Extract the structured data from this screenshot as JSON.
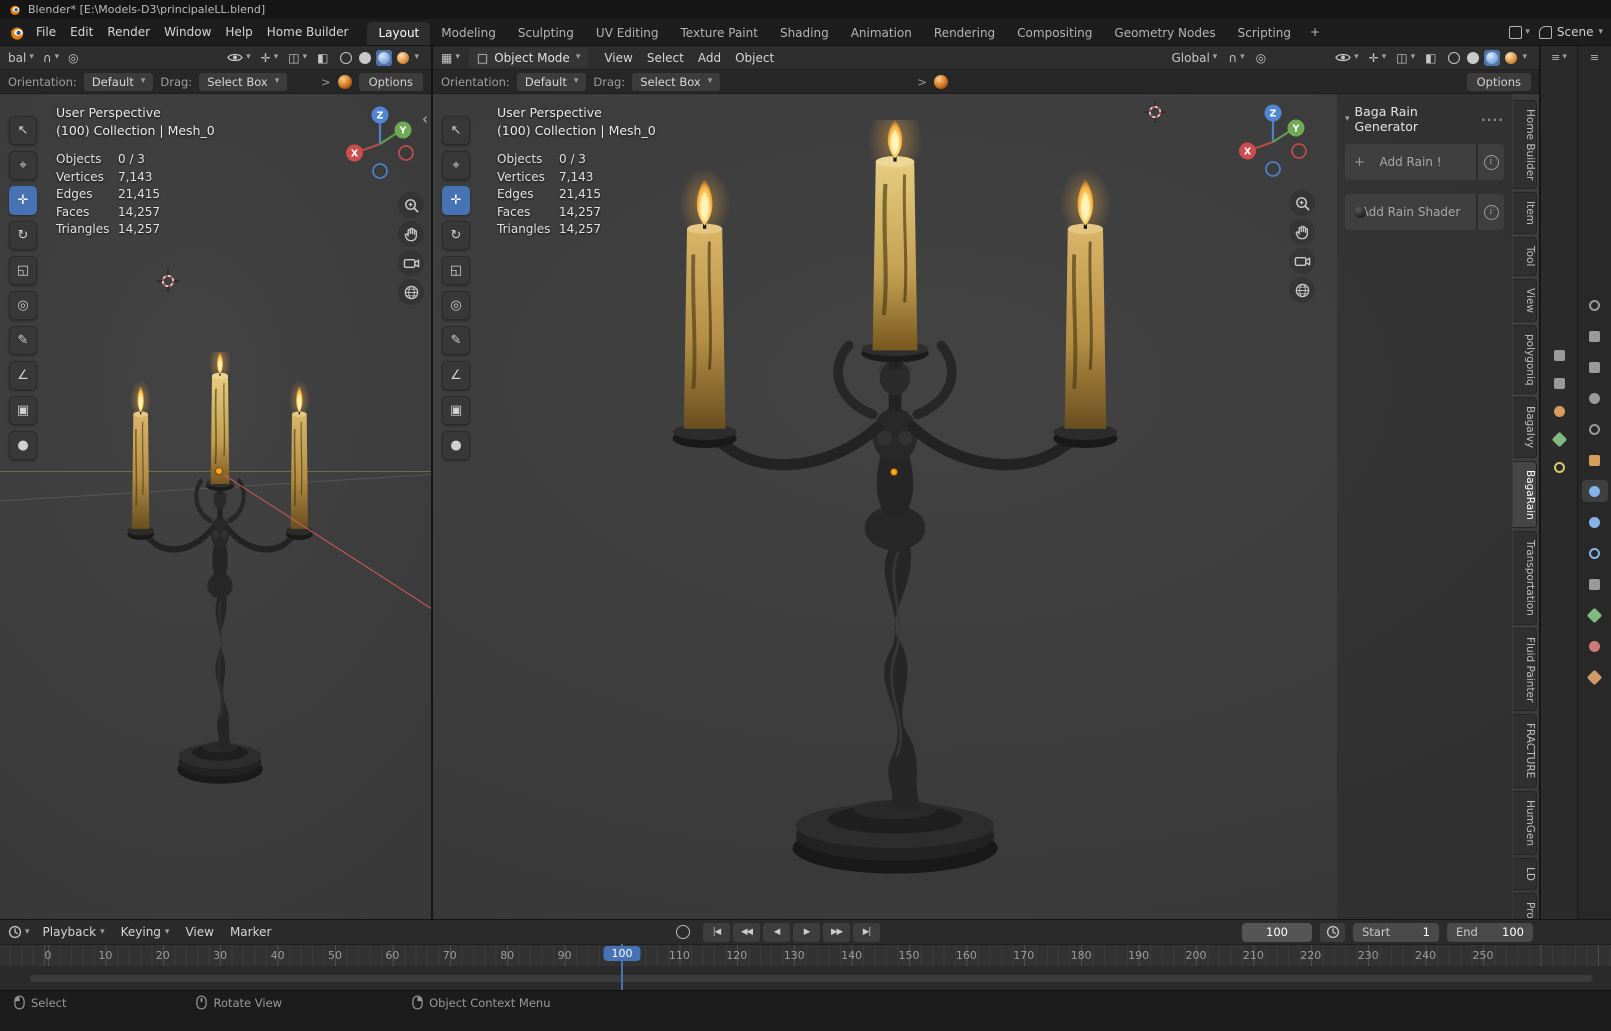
{
  "window": {
    "title": "Blender* [E:\\Models-D3\\principaleLL.blend]"
  },
  "icons": {
    "chevron_down": "▾",
    "expander": ">",
    "collapse_left": "‹",
    "magnet": "∩",
    "proportional_edit": "◎",
    "overlays": "◫",
    "xray": "◧",
    "gizmo_toggle": "✛",
    "editor_type_grid": "▦",
    "mode_cube": "□",
    "editor_list": "≡",
    "plus": "+",
    "info": "i",
    "panel_grip": "····"
  },
  "menubar": {
    "menus": [
      "File",
      "Edit",
      "Render",
      "Window",
      "Help",
      "Home Builder"
    ],
    "workspace_tabs": [
      "Layout",
      "Modeling",
      "Sculpting",
      "UV Editing",
      "Texture Paint",
      "Shading",
      "Animation",
      "Rendering",
      "Compositing",
      "Geometry Nodes",
      "Scripting"
    ],
    "active_tab": "Layout",
    "new_workspace_label": "+",
    "scene_selector": {
      "label": "Scene"
    }
  },
  "viewport_shared": {
    "header": {
      "mode_label": "Object Mode",
      "menus": [
        "View",
        "Select",
        "Add",
        "Object"
      ],
      "orientation": "Global"
    },
    "left_header_truncated": "bal",
    "tool_settings": {
      "orientation_label": "Orientation:",
      "orientation_value": "Default",
      "drag_label": "Drag:",
      "drag_value": "Select Box",
      "options_label": "Options"
    },
    "overlay": {
      "view_label": "User Perspective",
      "collection_label": "(100) Collection | Mesh_0",
      "stats": [
        {
          "label": "Objects",
          "value": "0 / 3"
        },
        {
          "label": "Vertices",
          "value": "7,143"
        },
        {
          "label": "Edges",
          "value": "21,415"
        },
        {
          "label": "Faces",
          "value": "14,257"
        },
        {
          "label": "Triangles",
          "value": "14,257"
        }
      ]
    }
  },
  "gizmo_axes": {
    "x": "X",
    "y": "Y",
    "z": "Z"
  },
  "tools": [
    {
      "name": "select-box",
      "glyph": "↖",
      "active": false
    },
    {
      "name": "cursor",
      "glyph": "⌖",
      "active": false
    },
    {
      "name": "move",
      "glyph": "✛",
      "active": true
    },
    {
      "name": "rotate",
      "glyph": "↻",
      "active": false
    },
    {
      "name": "scale",
      "glyph": "◱",
      "active": false
    },
    {
      "name": "transform",
      "glyph": "◎",
      "active": false
    },
    {
      "name": "annotate",
      "glyph": "✎",
      "active": false
    },
    {
      "name": "measure",
      "glyph": "∠",
      "active": false
    },
    {
      "name": "add-cube",
      "glyph": "▣",
      "active": false
    },
    {
      "name": "addon-tool",
      "glyph": "●",
      "active": false
    }
  ],
  "sidebar_panel": {
    "title": "Baga Rain Generator",
    "buttons": [
      {
        "label": "Add Rain !"
      },
      {
        "label": "Add Rain Shader"
      }
    ]
  },
  "sidebar_tabs": {
    "active": "BagaRain",
    "items": [
      "Home Builder",
      "Item",
      "Tool",
      "View",
      "polygoniq",
      "BagaIvy",
      "BagaRain",
      "Transportation",
      "Fluid Painter",
      "FRACTURE",
      "HumGen",
      "LD",
      "Procedural Cro"
    ]
  },
  "properties_tabs": {
    "items": [
      {
        "name": "render",
        "shape": "ring",
        "color": "#9a9a9a",
        "active": false
      },
      {
        "name": "output",
        "shape": "square",
        "color": "#9a9a9a",
        "active": false
      },
      {
        "name": "view-layer",
        "shape": "square",
        "color": "#9a9a9a",
        "active": false
      },
      {
        "name": "scene",
        "shape": "circle",
        "color": "#9a9a9a",
        "active": false
      },
      {
        "name": "world",
        "shape": "ring",
        "color": "#9a9a9a",
        "active": false
      },
      {
        "name": "object",
        "shape": "square",
        "color": "#d89c5a",
        "active": false
      },
      {
        "name": "modifiers",
        "shape": "circle",
        "color": "#84b3e8",
        "active": true
      },
      {
        "name": "particles",
        "shape": "circle",
        "color": "#84b3e8",
        "active": false
      },
      {
        "name": "physics",
        "shape": "ring",
        "color": "#84b3e8",
        "active": false
      },
      {
        "name": "constraints",
        "shape": "square",
        "color": "#9a9a9a",
        "active": false
      },
      {
        "name": "object-data",
        "shape": "diamond",
        "color": "#7fba7f",
        "active": false
      },
      {
        "name": "material",
        "shape": "circle",
        "color": "#cf7a7a",
        "active": false
      },
      {
        "name": "texture",
        "shape": "diamond",
        "color": "#cf9a6a",
        "active": false
      }
    ]
  },
  "outliner": {
    "items": [
      {
        "name": "filter",
        "shape": "square",
        "color": "#9a9a9a"
      },
      {
        "name": "collection",
        "shape": "square",
        "color": "#9a9a9a"
      },
      {
        "name": "object",
        "shape": "circle",
        "color": "#d89c5a"
      },
      {
        "name": "mesh-data",
        "shape": "diamond",
        "color": "#7fba7f"
      },
      {
        "name": "light",
        "shape": "ring",
        "color": "#d8c86a"
      }
    ]
  },
  "timeline": {
    "menus": [
      "Playback",
      "Keying",
      "View",
      "Marker"
    ],
    "transport": [
      {
        "name": "jump-to-start",
        "glyph": "|◀"
      },
      {
        "name": "prev-keyframe",
        "glyph": "◀◀"
      },
      {
        "name": "play-reverse",
        "glyph": "◀"
      },
      {
        "name": "play",
        "glyph": "▶"
      },
      {
        "name": "next-keyframe",
        "glyph": "▶▶"
      },
      {
        "name": "jump-to-end",
        "glyph": "▶|"
      }
    ],
    "current_frame": "100",
    "start_label": "Start",
    "start_value": "1",
    "end_label": "End",
    "end_value": "100",
    "ruler": {
      "frames": [
        "0",
        "10",
        "20",
        "30",
        "40",
        "50",
        "60",
        "70",
        "80",
        "90",
        "100",
        "110",
        "120",
        "130",
        "140",
        "150",
        "160",
        "170",
        "180",
        "190",
        "200",
        "210",
        "220",
        "230",
        "240",
        "250"
      ]
    },
    "playhead": {
      "frame": "100"
    }
  },
  "statusbar": {
    "hints": [
      {
        "button": "left",
        "label": "Select"
      },
      {
        "button": "middle",
        "label": "Rotate View"
      },
      {
        "button": "right",
        "label": "Object Context Menu"
      }
    ]
  }
}
